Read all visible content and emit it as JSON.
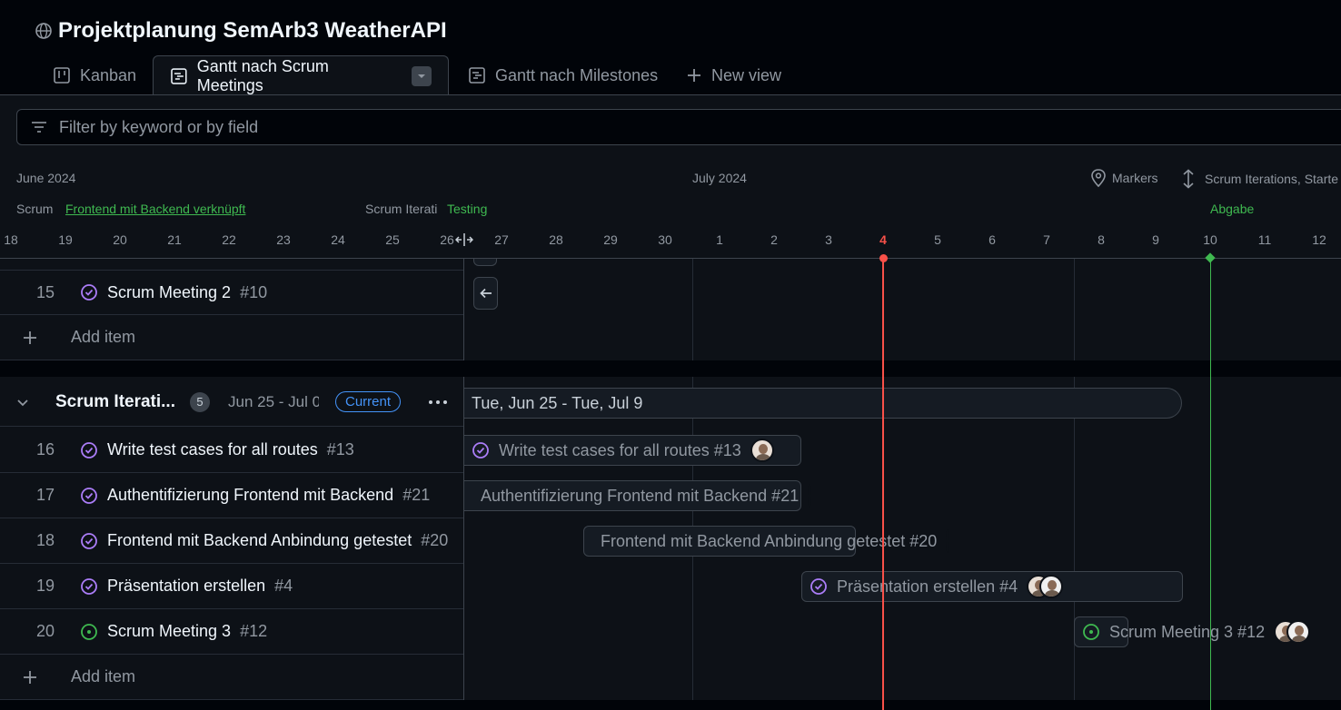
{
  "header": {
    "title": "Projektplanung SemArb3 WeatherAPI"
  },
  "tabs": [
    {
      "label": "Kanban"
    },
    {
      "label": "Gantt nach Scrum Meetings"
    },
    {
      "label": "Gantt nach Milestones"
    },
    {
      "label": "New view"
    }
  ],
  "filter": {
    "placeholder": "Filter by keyword or by field"
  },
  "timeline": {
    "month_june": "June 2024",
    "month_july": "July 2024",
    "markers_label": "Markers",
    "sort_label": "Scrum Iterations, Starte",
    "marker_scrum_1": "Scrum",
    "marker_frontend": "Frontend mit Backend verknüpft",
    "marker_scrum_2": "Scrum Iterati",
    "marker_testing": "Testing",
    "marker_abgabe": "Abgabe",
    "days": [
      "18",
      "19",
      "20",
      "21",
      "22",
      "23",
      "24",
      "25",
      "26",
      "27",
      "28",
      "29",
      "30",
      "1",
      "2",
      "3",
      "4",
      "5",
      "6",
      "7",
      "8",
      "9",
      "10",
      "11",
      "12"
    ],
    "today": "4",
    "milestone_day": "10"
  },
  "colors": {
    "today": "#f85149",
    "milestone": "#3fb950",
    "done": "#ab7df8",
    "open": "#3fb950",
    "accent": "#4493f8"
  },
  "group1": {
    "rows": [
      {
        "num": "15",
        "title": "Scrum Meeting 2",
        "issue": "#10",
        "status": "done"
      }
    ],
    "add_item": "Add item"
  },
  "group2": {
    "name": "Scrum Iterati...",
    "count": "5",
    "range": "Jun 25 - Jul 0",
    "badge": "Current",
    "bar_label": "Tue, Jun 25 - Tue, Jul 9",
    "rows": [
      {
        "num": "16",
        "title": "Write test cases for all routes",
        "issue": "#13",
        "status": "done",
        "bar": "Write test cases for all routes #13"
      },
      {
        "num": "17",
        "title": "Authentifizierung Frontend mit Backend",
        "issue": "#21",
        "status": "done",
        "bar": "Authentifizierung Frontend mit Backend #21"
      },
      {
        "num": "18",
        "title": "Frontend mit Backend Anbindung getestet",
        "issue": "#20",
        "status": "done",
        "bar": "Frontend mit Backend Anbindung getestet #20"
      },
      {
        "num": "19",
        "title": "Präsentation erstellen",
        "issue": "#4",
        "status": "done",
        "bar": "Präsentation erstellen #4"
      },
      {
        "num": "20",
        "title": "Scrum Meeting 3",
        "issue": "#12",
        "status": "open",
        "bar": "Scrum Meeting 3 #12"
      }
    ],
    "add_item": "Add item"
  }
}
